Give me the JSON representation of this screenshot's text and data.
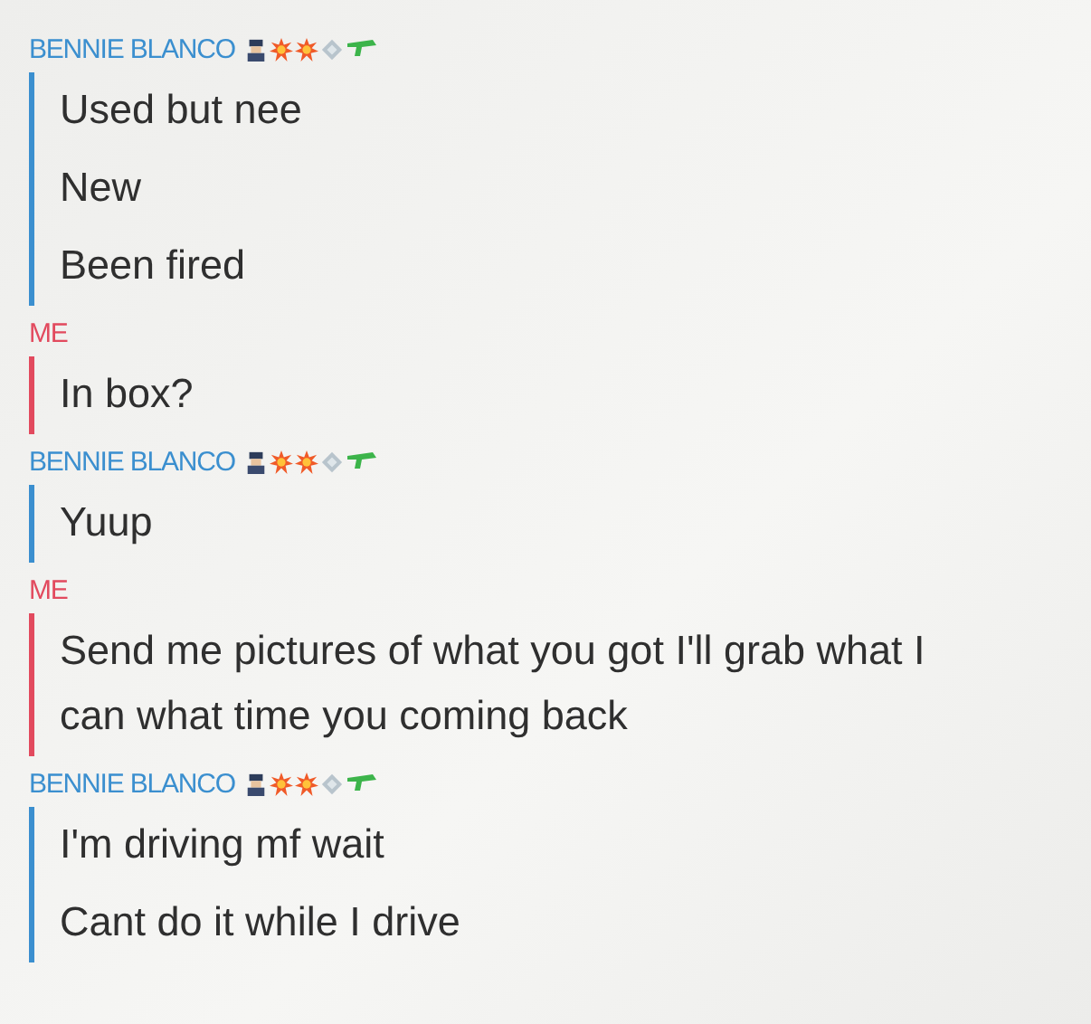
{
  "messages_groups": [
    {
      "kind": "friend",
      "name": "BENNIE BLANCO",
      "badges": true,
      "messages": [
        "Used but nee",
        "New",
        "Been fired"
      ]
    },
    {
      "kind": "me",
      "name": "ME",
      "badges": false,
      "messages": [
        "In box?"
      ]
    },
    {
      "kind": "friend",
      "name": "BENNIE BLANCO",
      "badges": true,
      "messages": [
        "Yuup"
      ]
    },
    {
      "kind": "me",
      "name": "ME",
      "badges": false,
      "messages": [
        "Send me pictures of what you got I'll grab what I can what time you coming back"
      ]
    },
    {
      "kind": "friend",
      "name": "BENNIE BLANCO",
      "badges": true,
      "messages": [
        "I'm driving mf wait",
        "Cant do it while I drive"
      ]
    }
  ]
}
